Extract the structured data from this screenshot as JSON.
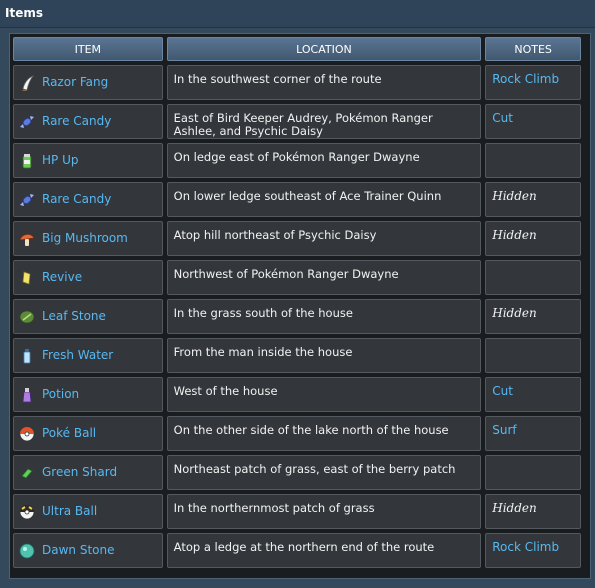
{
  "header": {
    "title": "Items"
  },
  "columns": {
    "item": "ITEM",
    "location": "LOCATION",
    "notes": "NOTES"
  },
  "rows": [
    {
      "item": "Razor Fang",
      "icon": "razor-fang-icon",
      "location": "In the southwest corner of the route",
      "notes": "Rock Climb",
      "notes_kind": "link"
    },
    {
      "item": "Rare Candy",
      "icon": "rare-candy-icon",
      "location": "East of Bird Keeper Audrey, Pokémon Ranger Ashlee, and Psychic Daisy",
      "notes": "Cut",
      "notes_kind": "link"
    },
    {
      "item": "HP Up",
      "icon": "hp-up-icon",
      "location": "On ledge east of Pokémon Ranger Dwayne",
      "notes": "",
      "notes_kind": "none"
    },
    {
      "item": "Rare Candy",
      "icon": "rare-candy-icon",
      "location": "On lower ledge southeast of Ace Trainer Quinn",
      "notes": "Hidden",
      "notes_kind": "hidden"
    },
    {
      "item": "Big Mushroom",
      "icon": "big-mushroom-icon",
      "location": "Atop hill northeast of Psychic Daisy",
      "notes": "Hidden",
      "notes_kind": "hidden"
    },
    {
      "item": "Revive",
      "icon": "revive-icon",
      "location": "Northwest of Pokémon Ranger Dwayne",
      "notes": "",
      "notes_kind": "none"
    },
    {
      "item": "Leaf Stone",
      "icon": "leaf-stone-icon",
      "location": "In the grass south of the house",
      "notes": "Hidden",
      "notes_kind": "hidden"
    },
    {
      "item": "Fresh Water",
      "icon": "fresh-water-icon",
      "location": "From the man inside the house",
      "notes": "",
      "notes_kind": "none"
    },
    {
      "item": "Potion",
      "icon": "potion-icon",
      "location": "West of the house",
      "notes": "Cut",
      "notes_kind": "link"
    },
    {
      "item": "Poké Ball",
      "icon": "poke-ball-icon",
      "location": "On the other side of the lake north of the house",
      "notes": "Surf",
      "notes_kind": "link"
    },
    {
      "item": "Green Shard",
      "icon": "green-shard-icon",
      "location": "Northeast patch of grass, east of the berry patch",
      "notes": "",
      "notes_kind": "none"
    },
    {
      "item": "Ultra Ball",
      "icon": "ultra-ball-icon",
      "location": "In the northernmost patch of grass",
      "notes": "Hidden",
      "notes_kind": "hidden"
    },
    {
      "item": "Dawn Stone",
      "icon": "dawn-stone-icon",
      "location": "Atop a ledge at the northern end of the route",
      "notes": "Rock Climb",
      "notes_kind": "link"
    }
  ]
}
